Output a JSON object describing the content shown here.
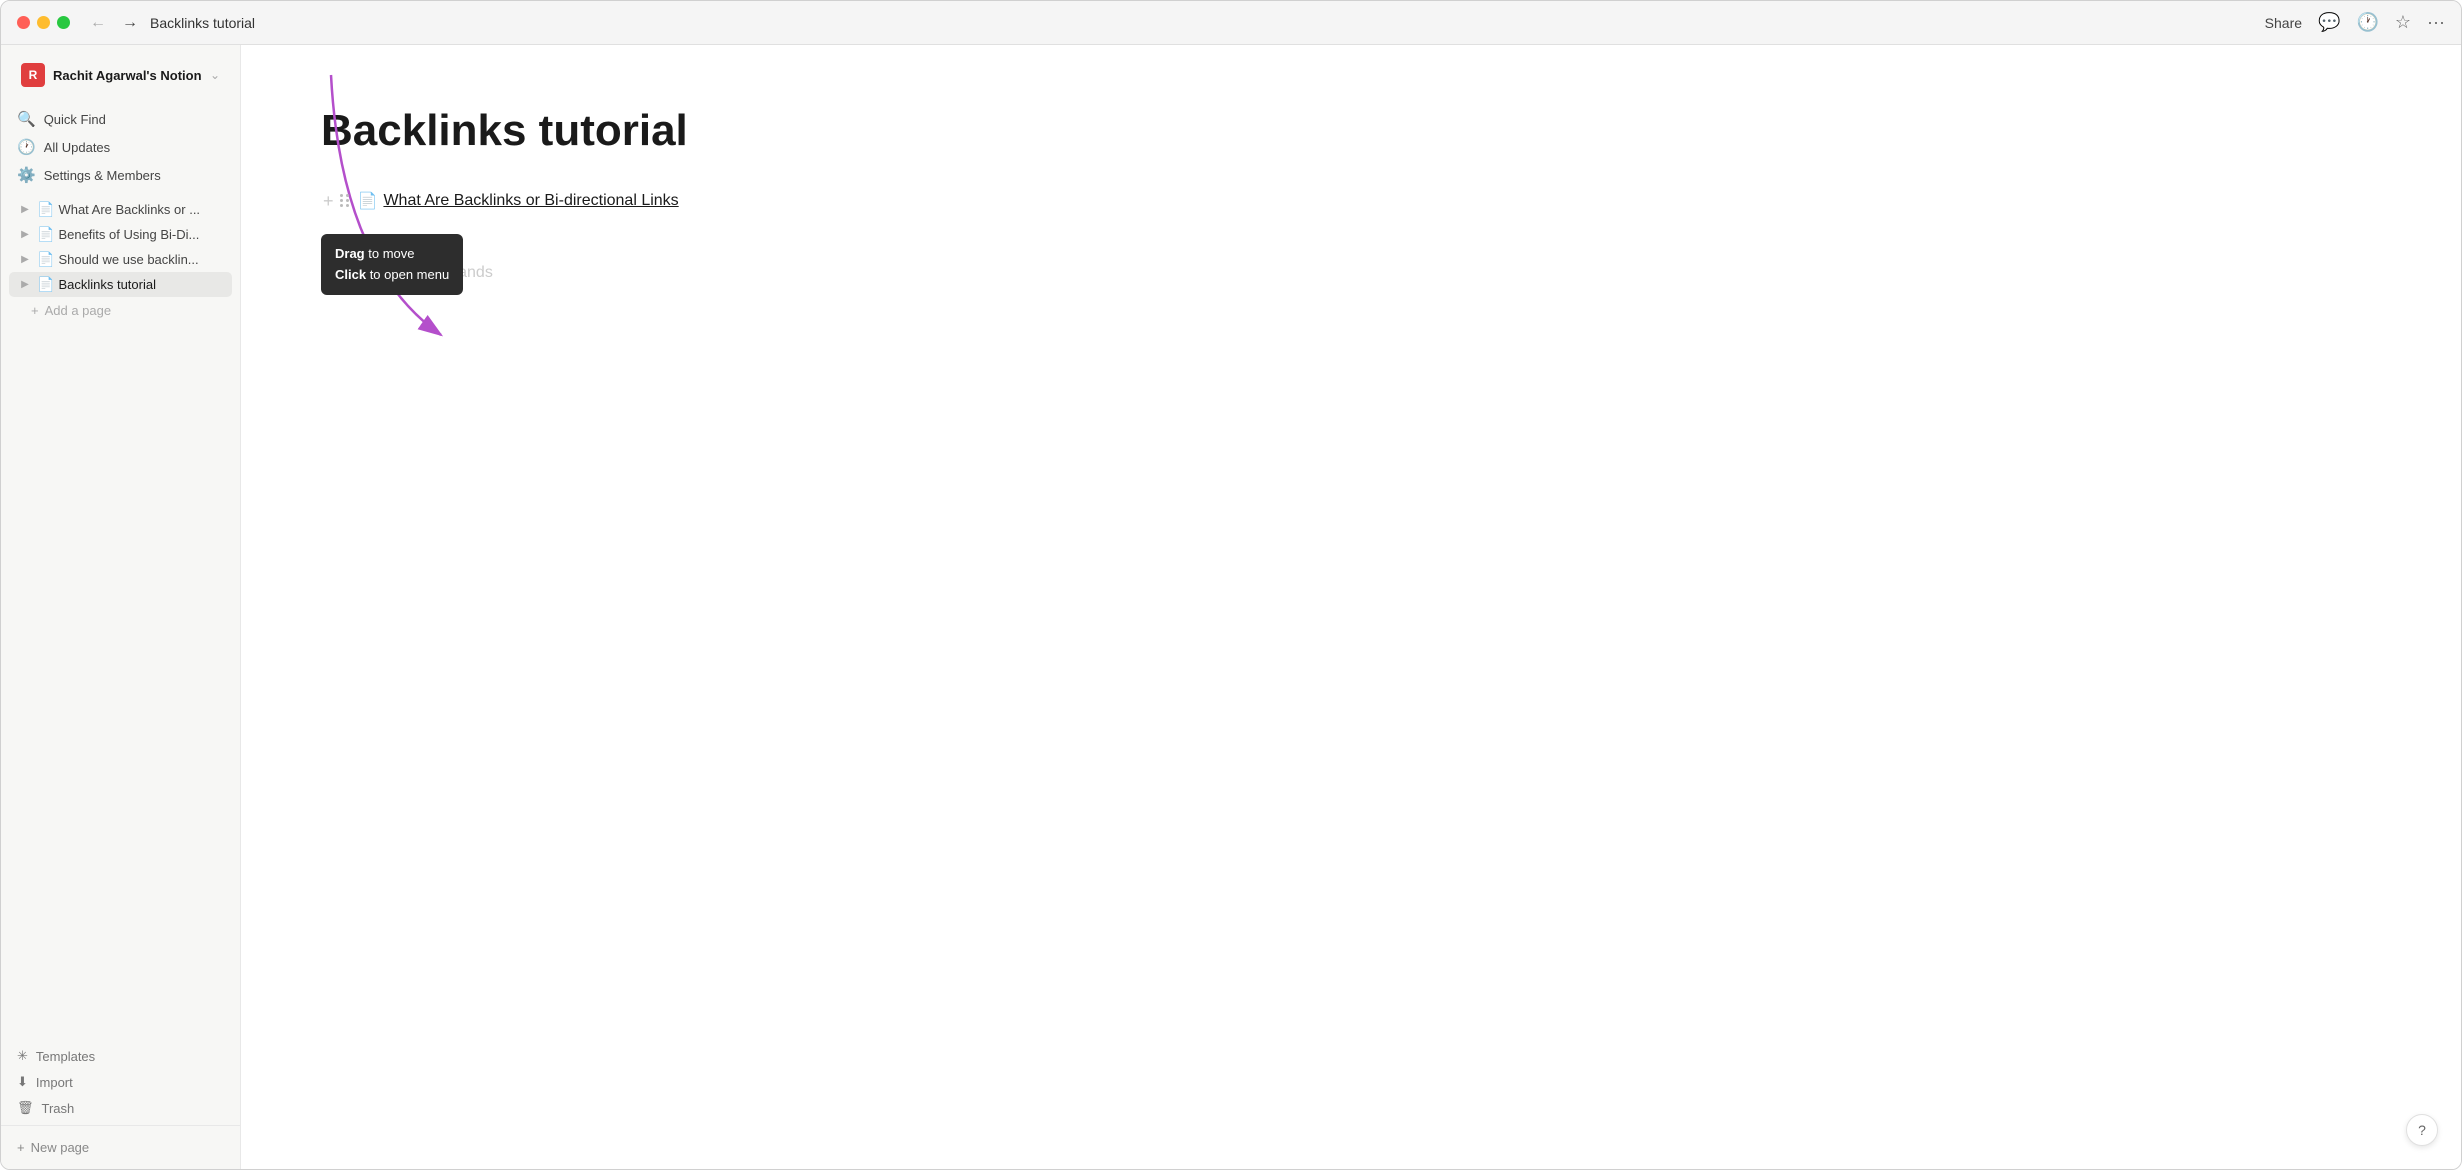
{
  "titlebar": {
    "page_name": "Backlinks tutorial",
    "share_label": "Share",
    "more_label": "···"
  },
  "sidebar": {
    "workspace": {
      "initial": "R",
      "name": "Rachit Agarwal's Notion",
      "avatar_color": "#e03e3e"
    },
    "nav_items": [
      {
        "id": "quick-find",
        "label": "Quick Find",
        "icon": "🔍"
      },
      {
        "id": "all-updates",
        "label": "All Updates",
        "icon": "🕐"
      },
      {
        "id": "settings",
        "label": "Settings & Members",
        "icon": "⚙️"
      }
    ],
    "pages": [
      {
        "id": "backlinks-what",
        "label": "What Are Backlinks or ..."
      },
      {
        "id": "benefits",
        "label": "Benefits of Using Bi-Di..."
      },
      {
        "id": "should-we",
        "label": "Should we use backlin..."
      },
      {
        "id": "backlinks-tutorial",
        "label": "Backlinks tutorial",
        "active": true
      }
    ],
    "add_page_label": "Add a page",
    "footer_items": [
      {
        "id": "templates",
        "label": "Templates",
        "icon": "✳"
      },
      {
        "id": "import",
        "label": "Import",
        "icon": "⬇"
      },
      {
        "id": "trash",
        "label": "Trash",
        "icon": "🗑"
      }
    ],
    "new_page_label": "New page"
  },
  "main": {
    "title": "Backlinks tutorial",
    "link_text": "What Are Backlinks or Bi-directional Links",
    "slash_hint": "for commands",
    "tooltip": {
      "drag_bold": "Drag",
      "drag_rest": " to move",
      "click_bold": "Click",
      "click_rest": " to open menu"
    }
  },
  "help": {
    "label": "?"
  }
}
